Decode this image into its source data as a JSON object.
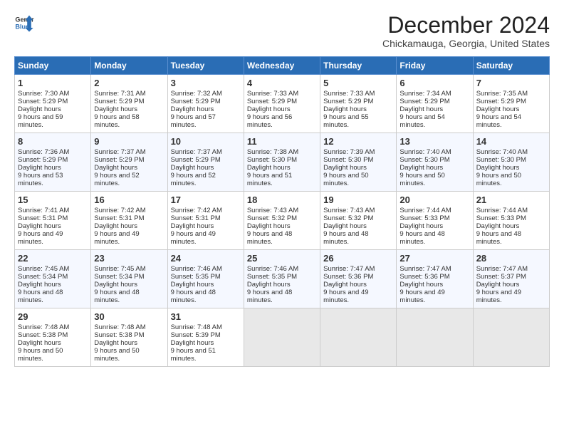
{
  "header": {
    "logo_line1": "General",
    "logo_line2": "Blue",
    "month": "December 2024",
    "location": "Chickamauga, Georgia, United States"
  },
  "weekdays": [
    "Sunday",
    "Monday",
    "Tuesday",
    "Wednesday",
    "Thursday",
    "Friday",
    "Saturday"
  ],
  "weeks": [
    [
      {
        "day": "1",
        "rise": "7:30 AM",
        "set": "5:29 PM",
        "hours": "9 hours and 59 minutes."
      },
      {
        "day": "2",
        "rise": "7:31 AM",
        "set": "5:29 PM",
        "hours": "9 hours and 58 minutes."
      },
      {
        "day": "3",
        "rise": "7:32 AM",
        "set": "5:29 PM",
        "hours": "9 hours and 57 minutes."
      },
      {
        "day": "4",
        "rise": "7:33 AM",
        "set": "5:29 PM",
        "hours": "9 hours and 56 minutes."
      },
      {
        "day": "5",
        "rise": "7:33 AM",
        "set": "5:29 PM",
        "hours": "9 hours and 55 minutes."
      },
      {
        "day": "6",
        "rise": "7:34 AM",
        "set": "5:29 PM",
        "hours": "9 hours and 54 minutes."
      },
      {
        "day": "7",
        "rise": "7:35 AM",
        "set": "5:29 PM",
        "hours": "9 hours and 54 minutes."
      }
    ],
    [
      {
        "day": "8",
        "rise": "7:36 AM",
        "set": "5:29 PM",
        "hours": "9 hours and 53 minutes."
      },
      {
        "day": "9",
        "rise": "7:37 AM",
        "set": "5:29 PM",
        "hours": "9 hours and 52 minutes."
      },
      {
        "day": "10",
        "rise": "7:37 AM",
        "set": "5:29 PM",
        "hours": "9 hours and 52 minutes."
      },
      {
        "day": "11",
        "rise": "7:38 AM",
        "set": "5:30 PM",
        "hours": "9 hours and 51 minutes."
      },
      {
        "day": "12",
        "rise": "7:39 AM",
        "set": "5:30 PM",
        "hours": "9 hours and 50 minutes."
      },
      {
        "day": "13",
        "rise": "7:40 AM",
        "set": "5:30 PM",
        "hours": "9 hours and 50 minutes."
      },
      {
        "day": "14",
        "rise": "7:40 AM",
        "set": "5:30 PM",
        "hours": "9 hours and 50 minutes."
      }
    ],
    [
      {
        "day": "15",
        "rise": "7:41 AM",
        "set": "5:31 PM",
        "hours": "9 hours and 49 minutes."
      },
      {
        "day": "16",
        "rise": "7:42 AM",
        "set": "5:31 PM",
        "hours": "9 hours and 49 minutes."
      },
      {
        "day": "17",
        "rise": "7:42 AM",
        "set": "5:31 PM",
        "hours": "9 hours and 49 minutes."
      },
      {
        "day": "18",
        "rise": "7:43 AM",
        "set": "5:32 PM",
        "hours": "9 hours and 48 minutes."
      },
      {
        "day": "19",
        "rise": "7:43 AM",
        "set": "5:32 PM",
        "hours": "9 hours and 48 minutes."
      },
      {
        "day": "20",
        "rise": "7:44 AM",
        "set": "5:33 PM",
        "hours": "9 hours and 48 minutes."
      },
      {
        "day": "21",
        "rise": "7:44 AM",
        "set": "5:33 PM",
        "hours": "9 hours and 48 minutes."
      }
    ],
    [
      {
        "day": "22",
        "rise": "7:45 AM",
        "set": "5:34 PM",
        "hours": "9 hours and 48 minutes."
      },
      {
        "day": "23",
        "rise": "7:45 AM",
        "set": "5:34 PM",
        "hours": "9 hours and 48 minutes."
      },
      {
        "day": "24",
        "rise": "7:46 AM",
        "set": "5:35 PM",
        "hours": "9 hours and 48 minutes."
      },
      {
        "day": "25",
        "rise": "7:46 AM",
        "set": "5:35 PM",
        "hours": "9 hours and 48 minutes."
      },
      {
        "day": "26",
        "rise": "7:47 AM",
        "set": "5:36 PM",
        "hours": "9 hours and 49 minutes."
      },
      {
        "day": "27",
        "rise": "7:47 AM",
        "set": "5:36 PM",
        "hours": "9 hours and 49 minutes."
      },
      {
        "day": "28",
        "rise": "7:47 AM",
        "set": "5:37 PM",
        "hours": "9 hours and 49 minutes."
      }
    ],
    [
      {
        "day": "29",
        "rise": "7:48 AM",
        "set": "5:38 PM",
        "hours": "9 hours and 50 minutes."
      },
      {
        "day": "30",
        "rise": "7:48 AM",
        "set": "5:38 PM",
        "hours": "9 hours and 50 minutes."
      },
      {
        "day": "31",
        "rise": "7:48 AM",
        "set": "5:39 PM",
        "hours": "9 hours and 51 minutes."
      },
      null,
      null,
      null,
      null
    ]
  ]
}
